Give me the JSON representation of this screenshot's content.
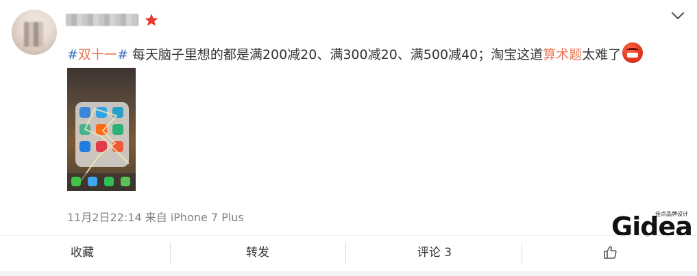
{
  "post": {
    "tag": "双十一",
    "tag_hash_open": "#",
    "tag_hash_close": "#",
    "text_main": " 每天脑子里想的都是满200减20、满300减20、满500减40；淘宝这道",
    "text_link": "算术题",
    "text_tail": "太难了",
    "timestamp": "11月2日22:14",
    "source": "来自 iPhone 7 Plus",
    "emoji": "angry-emoji",
    "image": "phone-screenshot-thumbnail"
  },
  "actions": {
    "favorite": "收藏",
    "repost": "转发",
    "comment": "评论 3",
    "like_icon": "thumbs-up-icon"
  },
  "watermark": {
    "logo": "Gidea",
    "sub": "佳点品牌设计"
  },
  "colors": {
    "tag": "#eb7350",
    "hash": "#3b6fb8",
    "meta": "#808080",
    "vip": "#e8372c"
  }
}
